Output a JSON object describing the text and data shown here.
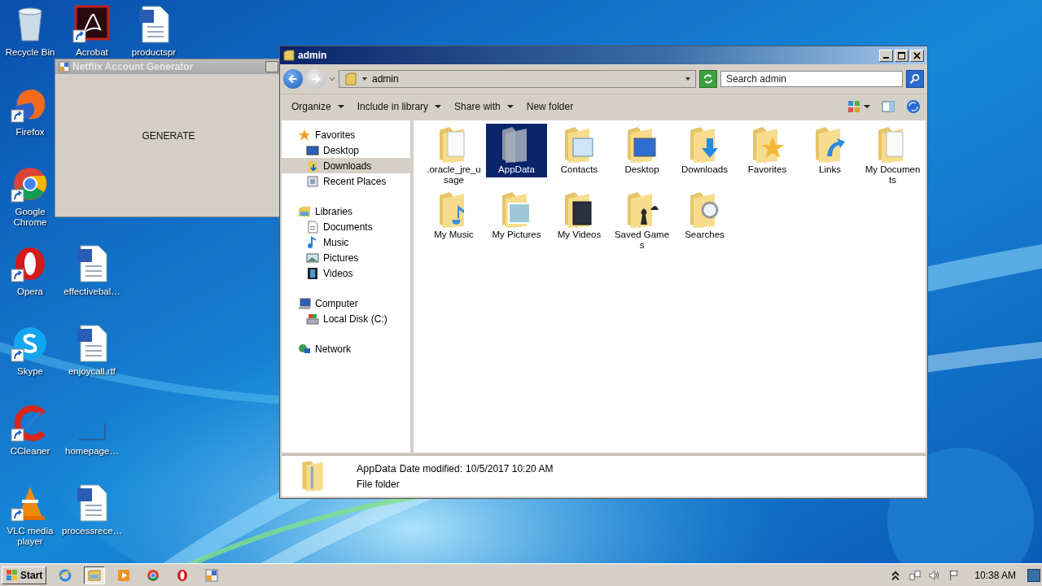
{
  "desktop_icons": [
    {
      "label": "Recycle Bin",
      "kind": "recycle-bin",
      "shortcut": false
    },
    {
      "label": "Acrobat",
      "kind": "acrobat",
      "shortcut": true
    },
    {
      "label": "productspr",
      "kind": "word",
      "shortcut": false
    },
    {
      "label": "Firefox",
      "kind": "firefox",
      "shortcut": true
    },
    {
      "label": "Google Chrome",
      "kind": "chrome",
      "shortcut": true
    },
    {
      "label": "Opera",
      "kind": "opera",
      "shortcut": true
    },
    {
      "label": "effectivebal…",
      "kind": "word",
      "shortcut": false
    },
    {
      "label": "Skype",
      "kind": "skype",
      "shortcut": true
    },
    {
      "label": "enjoycall.rtf",
      "kind": "word",
      "shortcut": false
    },
    {
      "label": "CCleaner",
      "kind": "ccleaner",
      "shortcut": true
    },
    {
      "label": "homepage…",
      "kind": "blank",
      "shortcut": false
    },
    {
      "label": "VLC media player",
      "kind": "vlc",
      "shortcut": true
    },
    {
      "label": "processrece…",
      "kind": "word",
      "shortcut": false
    }
  ],
  "generator_window": {
    "title": "Netflix Account Generator",
    "button": "GENERATE"
  },
  "explorer": {
    "title": "admin",
    "address": "admin",
    "search": {
      "placeholder": "Search admin"
    },
    "toolbar": [
      {
        "label": "Organize",
        "dropdown": true
      },
      {
        "label": "Include in library",
        "dropdown": true
      },
      {
        "label": "Share with",
        "dropdown": true
      },
      {
        "label": "New folder",
        "dropdown": false
      }
    ],
    "nav": [
      {
        "label": "Favorites",
        "kind": "star",
        "selected": false,
        "children": [
          {
            "label": "Desktop",
            "kind": "desktop",
            "selected": false
          },
          {
            "label": "Downloads",
            "kind": "downloads",
            "selected": true
          },
          {
            "label": "Recent Places",
            "kind": "recent",
            "selected": false
          }
        ]
      },
      {
        "label": "Libraries",
        "kind": "library",
        "selected": false,
        "children": [
          {
            "label": "Documents",
            "kind": "documents",
            "selected": false
          },
          {
            "label": "Music",
            "kind": "music",
            "selected": false
          },
          {
            "label": "Pictures",
            "kind": "pictures",
            "selected": false
          },
          {
            "label": "Videos",
            "kind": "videos",
            "selected": false
          }
        ]
      },
      {
        "label": "Computer",
        "kind": "computer",
        "selected": false,
        "children": [
          {
            "label": "Local Disk (C:)",
            "kind": "disk",
            "selected": false
          }
        ]
      },
      {
        "label": "Network",
        "kind": "network",
        "selected": false
      }
    ],
    "items": [
      {
        "label": ".oracle_jre_usage",
        "kind": "doc",
        "selected": false
      },
      {
        "label": "AppData",
        "kind": "hidden",
        "selected": true
      },
      {
        "label": "Contacts",
        "kind": "contacts",
        "selected": false
      },
      {
        "label": "Desktop",
        "kind": "desktop",
        "selected": false
      },
      {
        "label": "Downloads",
        "kind": "downloads",
        "selected": false
      },
      {
        "label": "Favorites",
        "kind": "favorites",
        "selected": false
      },
      {
        "label": "Links",
        "kind": "links",
        "selected": false
      },
      {
        "label": "My Documents",
        "kind": "documents",
        "selected": false
      },
      {
        "label": "My Music",
        "kind": "music",
        "selected": false
      },
      {
        "label": "My Pictures",
        "kind": "pictures",
        "selected": false
      },
      {
        "label": "My Videos",
        "kind": "videos",
        "selected": false
      },
      {
        "label": "Saved Games",
        "kind": "games",
        "selected": false
      },
      {
        "label": "Searches",
        "kind": "searches",
        "selected": false
      }
    ],
    "details": {
      "name": "AppData",
      "modified_label": "Date modified:",
      "modified": "10/5/2017 10:20 AM",
      "type": "File folder"
    }
  },
  "taskbar": {
    "start": "Start",
    "apps": [
      {
        "kind": "ie",
        "active": false
      },
      {
        "kind": "explorer",
        "active": true
      },
      {
        "kind": "media",
        "active": false
      },
      {
        "kind": "chrome",
        "active": false
      },
      {
        "kind": "opera",
        "active": false
      },
      {
        "kind": "app",
        "active": false
      }
    ],
    "clock": "10:38 AM"
  }
}
